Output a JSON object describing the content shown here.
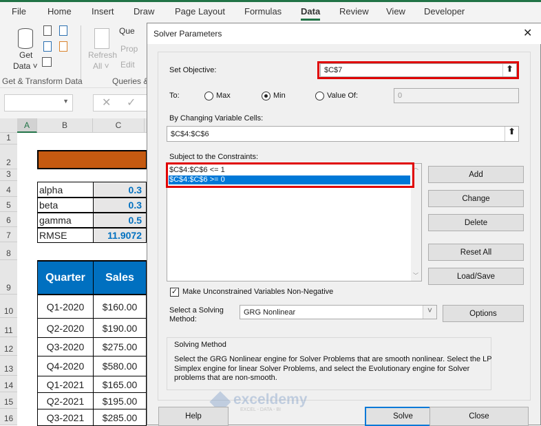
{
  "ribbon": {
    "tabs": [
      "File",
      "Home",
      "Insert",
      "Draw",
      "Page Layout",
      "Formulas",
      "Data",
      "Review",
      "View",
      "Developer"
    ],
    "active_tab": "Data",
    "get_data": "Get",
    "get_data2": "Data ˅",
    "refresh": "Refresh",
    "refresh2": "All ˅",
    "queries": "Que",
    "properties": "Prop",
    "edit": "Edit",
    "group1": "Get & Transform Data",
    "group2": "Queries &"
  },
  "sheet": {
    "columns": [
      "A",
      "B",
      "C"
    ],
    "rows": [
      "1",
      "2",
      "3",
      "4",
      "5",
      "6",
      "7",
      "8",
      "9",
      "10",
      "11",
      "12",
      "13",
      "14",
      "15",
      "16"
    ],
    "params": [
      {
        "name": "alpha",
        "value": "0.3"
      },
      {
        "name": "beta",
        "value": "0.3"
      },
      {
        "name": "gamma",
        "value": "0.5"
      },
      {
        "name": "RMSE",
        "value": "11.9072"
      }
    ],
    "headers": [
      "Quarter",
      "Sales"
    ],
    "data": [
      [
        "Q1-2020",
        "$160.00"
      ],
      [
        "Q2-2020",
        "$190.00"
      ],
      [
        "Q3-2020",
        "$275.00"
      ],
      [
        "Q4-2020",
        "$580.00"
      ],
      [
        "Q1-2021",
        "$165.00"
      ],
      [
        "Q2-2021",
        "$195.00"
      ],
      [
        "Q3-2021",
        "$285.00"
      ]
    ]
  },
  "dialog": {
    "title": "Solver Parameters",
    "close": "✕",
    "set_objective_label": "Set Objective:",
    "objective": "$C$7",
    "to_label": "To:",
    "max": "Max",
    "min": "Min",
    "value_of": "Value Of:",
    "value": "0",
    "selected": "Min",
    "changing_label": "By Changing Variable Cells:",
    "changing": "$C$4:$C$6",
    "constraints_label": "Subject to the Constraints:",
    "constraints": [
      "$C$4:$C$6 <= 1",
      "$C$4:$C$6 >= 0"
    ],
    "buttons": {
      "add": "Add",
      "change": "Change",
      "delete": "Delete",
      "reset": "Reset All",
      "load": "Load/Save",
      "options": "Options",
      "help": "Help",
      "solve": "Solve",
      "close": "Close"
    },
    "nonneg_label": "Make Unconstrained Variables Non-Negative",
    "nonneg_checked": true,
    "method_label1": "Select a Solving",
    "method_label2": "Method:",
    "method": "GRG Nonlinear",
    "group_title": "Solving Method",
    "group_text": "Select the GRG Nonlinear engine for Solver Problems that are smooth nonlinear. Select the LP Simplex engine for linear Solver Problems, and select the Evolutionary engine for Solver problems that are non-smooth."
  },
  "watermark": {
    "name": "exceldemy",
    "tagline": "EXCEL - DATA - BI"
  }
}
